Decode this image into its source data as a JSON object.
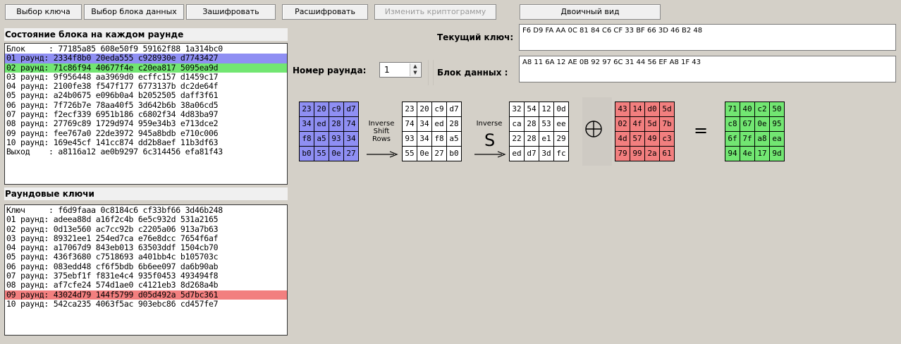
{
  "toolbar": {
    "select_key": "Выбор ключа",
    "select_block": "Выбор блока данных",
    "encrypt": "Зашифровать",
    "decrypt": "Расшифровать",
    "change_cryptogram": "Изменить криптограмму",
    "binary_view": "Двоичный вид"
  },
  "state_section": {
    "title": "Состояние блока на каждом раунде",
    "rows": [
      "Блок     : 77185a85 608e50f9 59162f88 1a314bc0",
      "01 раунд: 2334f8b0 20eda555 c928930e d7743427",
      "02 раунд: 71c86f94 40677f4e c20ea817 5095ea9d",
      "03 раунд: 9f956448 aa3969d0 ecffc157 d1459c17",
      "04 раунд: 2100fe38 f547f177 6773137b dc2de64f",
      "05 раунд: a24b0675 e096b0a4 b2052505 daff3f61",
      "06 раунд: 7f726b7e 78aa40f5 3d642b6b 38a06cd5",
      "07 раунд: f2ecf339 6951b186 c6802f34 4d83ba97",
      "08 раунд: 27769c89 1729d974 959e34b3 e713dce2",
      "09 раунд: fee767a0 22de3972 945a8bdb e710c006",
      "10 раунд: 169e45cf 141cc874 dd2b8aef 11b3df63",
      "Выход    : a8116a12 ae0b9297 6c314456 efa81f43"
    ]
  },
  "keys_section": {
    "title": "Раундовые ключи",
    "rows": [
      "Ключ     : f6d9faaa 0c8184c6 cf33bf66 3d46b248",
      "01 раунд: adeea88d a16f2c4b 6e5c932d 531a2165",
      "02 раунд: 0d13e560 ac7cc92b c2205a06 913a7b63",
      "03 раунд: 89321ee1 254ed7ca e76e8dcc 7654f6af",
      "04 раунд: a17067d9 843eb013 63503ddf 1504cb70",
      "05 раунд: 436f3680 c7518693 a401bb4c b105703c",
      "06 раунд: 083edd48 cf6f5bdb 6b6ee097 da6b90ab",
      "07 раунд: 375ebf1f f831e4c4 935f0453 493494f8",
      "08 раунд: af7cfe24 574d1ae0 c4121eb3 8d268a4b",
      "09 раунд: 43024d79 144f5799 d05d492a 5d7bc361",
      "10 раунд: 542ca235 4063f5ac 903ebc86 cd457fe7"
    ]
  },
  "current_key": {
    "label": "Текущий ключ:",
    "value": "F6 D9 FA AA 0C 81 84 C6 CF 33 BF 66 3D 46 B2 48"
  },
  "data_block": {
    "label": "Блок данных :",
    "value": "A8 11 6A 12 AE 0B 92 97 6C 31 44 56 EF A8 1F 43"
  },
  "round_number": {
    "label": "Номер раунда:",
    "value": "1"
  },
  "operations": {
    "shift_rows": "Inverse Shift Rows",
    "sub_bytes_top": "Inverse",
    "sub_bytes_symbol": "S",
    "equals": "="
  },
  "matrices": {
    "input": [
      "23",
      "20",
      "c9",
      "d7",
      "34",
      "ed",
      "28",
      "74",
      "f8",
      "a5",
      "93",
      "34",
      "b0",
      "55",
      "0e",
      "27"
    ],
    "after_shift": [
      "23",
      "20",
      "c9",
      "d7",
      "74",
      "34",
      "ed",
      "28",
      "93",
      "34",
      "f8",
      "a5",
      "55",
      "0e",
      "27",
      "b0"
    ],
    "after_sbox": [
      "32",
      "54",
      "12",
      "0d",
      "ca",
      "28",
      "53",
      "ee",
      "22",
      "28",
      "e1",
      "29",
      "ed",
      "d7",
      "3d",
      "fc"
    ],
    "round_key": [
      "43",
      "14",
      "d0",
      "5d",
      "02",
      "4f",
      "5d",
      "7b",
      "4d",
      "57",
      "49",
      "c3",
      "79",
      "99",
      "2a",
      "61"
    ],
    "result": [
      "71",
      "40",
      "c2",
      "50",
      "c8",
      "67",
      "0e",
      "95",
      "6f",
      "7f",
      "a8",
      "ea",
      "94",
      "4e",
      "17",
      "9d"
    ]
  },
  "colors": {
    "blue": "#8f8ff3",
    "green": "#72e672",
    "red": "#f27f7f"
  }
}
